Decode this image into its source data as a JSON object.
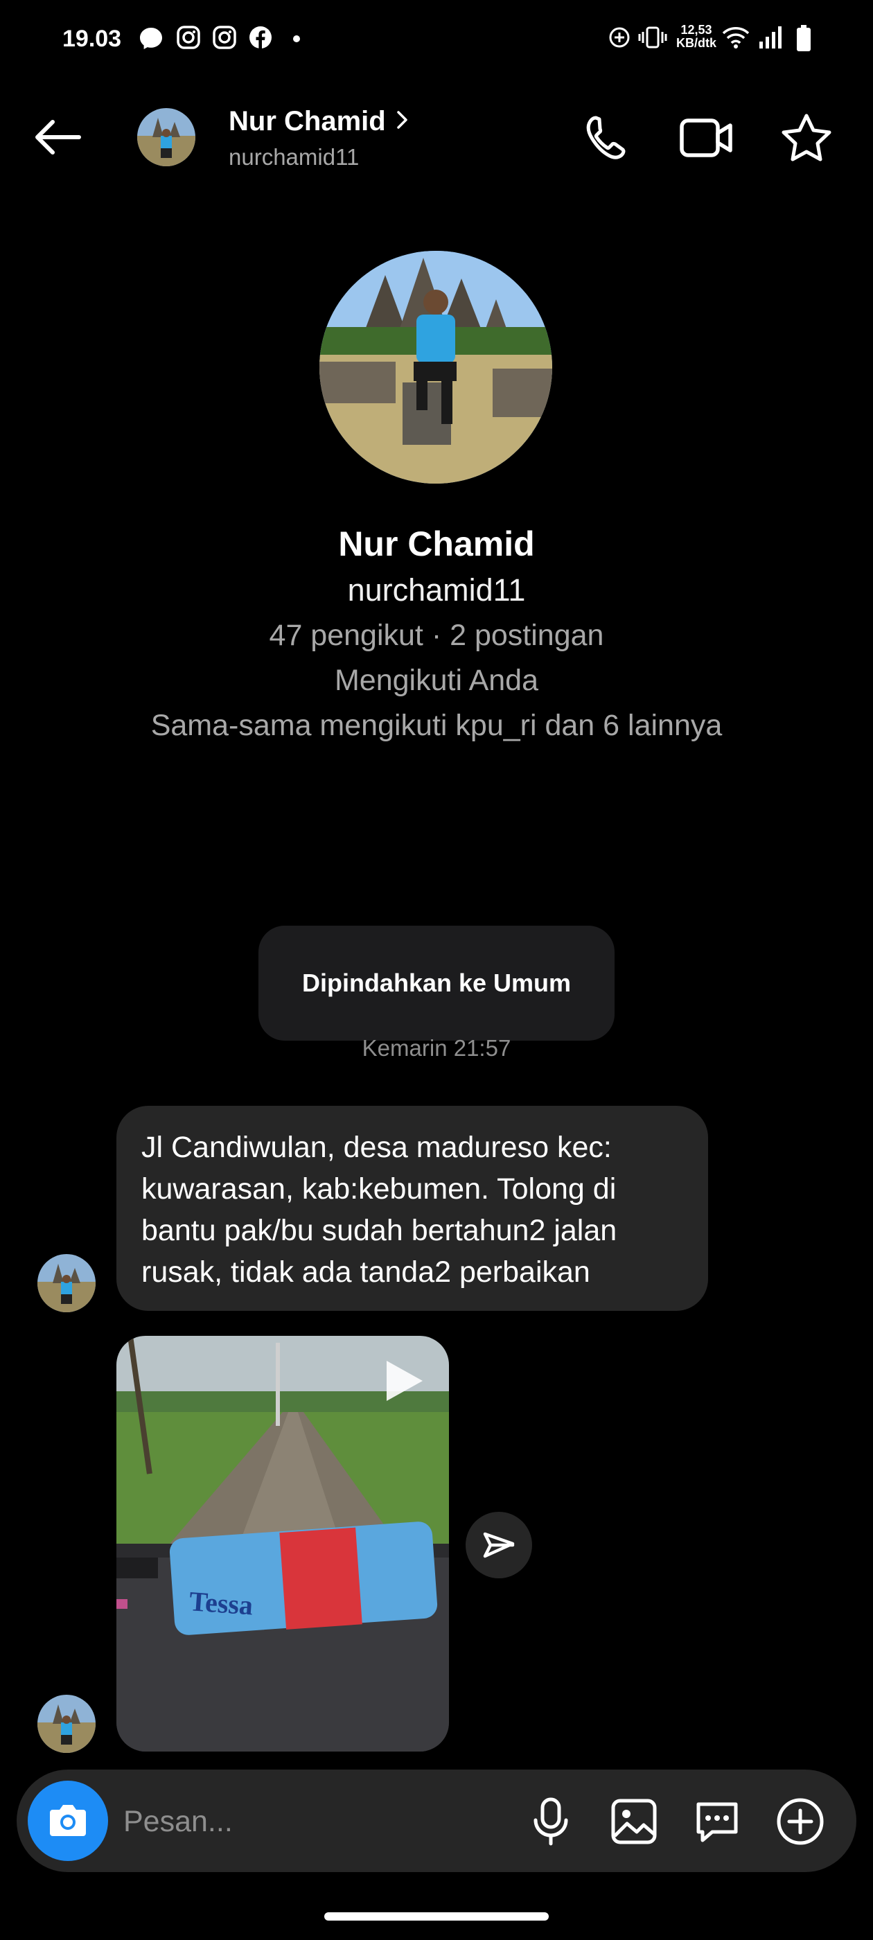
{
  "status_bar": {
    "time": "19.03",
    "network_speed_line1": "12,53",
    "network_speed_line2": "KB/dtk",
    "notification_icons": [
      "messenger-icon",
      "instagram-icon",
      "instagram-icon",
      "facebook-icon",
      "dot-icon"
    ],
    "system_icons": [
      "data-saver-icon",
      "vibrate-icon",
      "wifi-icon",
      "signal-icon",
      "battery-icon"
    ]
  },
  "header": {
    "name": "Nur Chamid",
    "username": "nurchamid11",
    "actions": [
      "back-arrow-icon",
      "phone-icon",
      "video-call-icon",
      "star-icon"
    ]
  },
  "profile": {
    "name": "Nur Chamid",
    "username": "nurchamid11",
    "stats": "47 pengikut · 2 postingan",
    "follow_status": "Mengikuti Anda",
    "mutual": "Sama-sama mengikuti kpu_ri dan 6 lainnya"
  },
  "system_message": {
    "text": "Dipindahkan ke Umum",
    "timestamp": "Kemarin 21:57"
  },
  "messages": {
    "text_line1": "Jl Candiwulan, desa madureso kec:",
    "text_line2": "kuwarasan, kab:kebumen. Tolong di",
    "text_line3": "bantu pak/bu sudah bertahun2 jalan",
    "text_line4": "rusak, tidak ada tanda2 perbaikan",
    "video_package_label": "Tessa"
  },
  "composer": {
    "placeholder": "Pesan..."
  },
  "colors": {
    "background": "#000000",
    "bubble": "#262626",
    "accent": "#1d8cf5",
    "secondary_text": "#a8a8a8"
  }
}
